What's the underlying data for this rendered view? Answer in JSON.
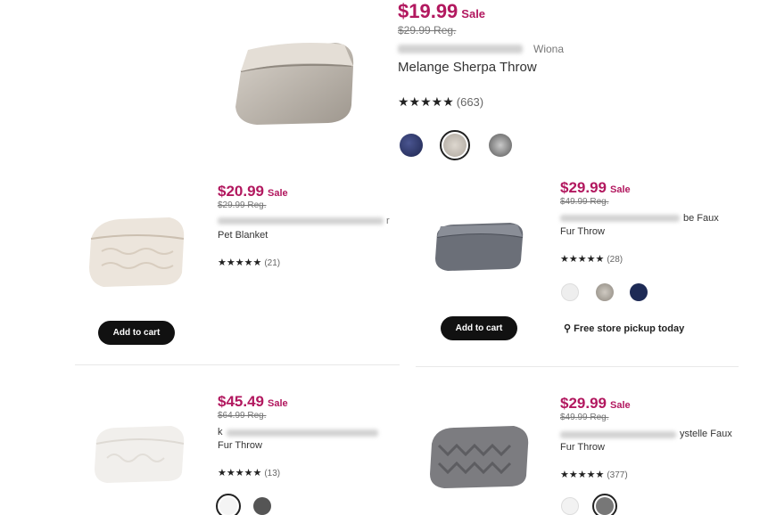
{
  "products": [
    {
      "price": "$19.99",
      "sale_label": "Sale",
      "reg_price": "$29.99 Reg.",
      "title_line1_visible": "Wiona",
      "title_line2": "Melange Sherpa Throw",
      "stars": "★★★★★",
      "review_count": "(663)",
      "swatches": [
        "#2b3566",
        "#cfc9c0",
        "#9a9a9a"
      ],
      "selected_swatch": 1
    },
    {
      "price": "$20.99",
      "sale_label": "Sale",
      "reg_price": "$29.99 Reg.",
      "title_line1_visible": "r",
      "title_line2": "Pet Blanket",
      "stars": "★★★★★",
      "review_count": "(21)",
      "add_to_cart": "Add to cart"
    },
    {
      "price": "$29.99",
      "sale_label": "Sale",
      "reg_price": "$49.99 Reg.",
      "title_line1_visible": "be Faux",
      "title_line2": "Fur Throw",
      "stars": "★★★★★",
      "review_count": "(28)",
      "swatches": [
        "#ececec",
        "#a8a39b",
        "#1d2a55"
      ],
      "add_to_cart": "Add to cart",
      "pickup": "Free store pickup today"
    },
    {
      "price": "$45.49",
      "sale_label": "Sale",
      "reg_price": "$64.99 Reg.",
      "title_line1_visible": "k",
      "title_line2": "Fur Throw",
      "stars": "★★★★★",
      "review_count": "(13)",
      "swatches": [
        "#f4f4f4",
        "#555555"
      ],
      "selected_swatch": 0
    },
    {
      "price": "$29.99",
      "sale_label": "Sale",
      "reg_price": "$49.99 Reg.",
      "title_line1_visible": "ystelle Faux",
      "title_line2": "Fur Throw",
      "stars": "★★★★★",
      "review_count": "(377)",
      "swatches": [
        "#f2f2f2",
        "#777777"
      ],
      "selected_swatch": 1
    }
  ],
  "icons": {
    "pickup": "location-pin-icon"
  },
  "colors": {
    "sale_price": "#b2185f",
    "button": "#111111"
  }
}
